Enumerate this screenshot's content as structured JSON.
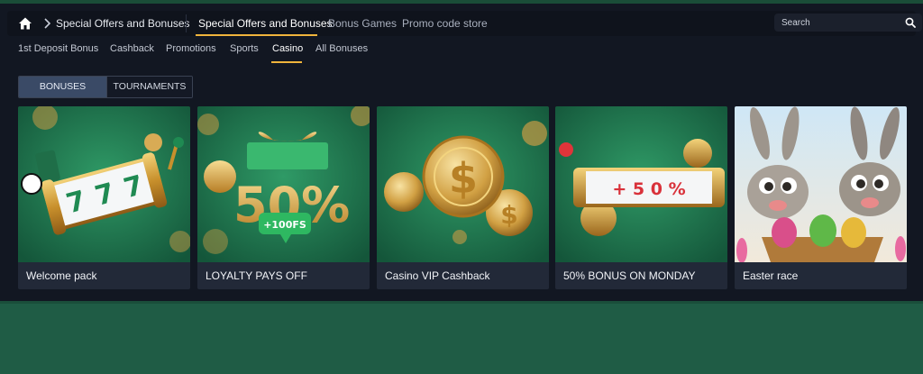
{
  "breadcrumb": {
    "label": "Special Offers and Bonuses"
  },
  "main_tabs": [
    {
      "label": "Special Offers and Bonuses",
      "active": true
    },
    {
      "label": "Bonus Games",
      "active": false
    },
    {
      "label": "Promo code store",
      "active": false
    }
  ],
  "search": {
    "placeholder": "Search"
  },
  "sub_tabs": [
    {
      "label": "1st Deposit Bonus"
    },
    {
      "label": "Cashback"
    },
    {
      "label": "Promotions"
    },
    {
      "label": "Sports"
    },
    {
      "label": "Casino",
      "active": true
    },
    {
      "label": "All Bonuses"
    }
  ],
  "toggle": {
    "bonuses": "BONUSES",
    "tournaments": "TOURNAMENTS",
    "selected": "BONUSES"
  },
  "cards": [
    {
      "title": "Welcome pack",
      "art": "slot-machine-777"
    },
    {
      "title": "LOYALTY PAYS OFF",
      "art": "gift-50-percent",
      "badge": "+100FS",
      "number": "50%"
    },
    {
      "title": "Casino VIP Cashback",
      "art": "gold-dollar-coins"
    },
    {
      "title": "50% BONUS ON MONDAY",
      "art": "slot-reel-50-percent",
      "reel": "+ 5 0 %"
    },
    {
      "title": "Easter race",
      "art": "easter-bunnies"
    }
  ],
  "colors": {
    "accent": "#f0b43c",
    "panel": "#121722",
    "green": "#1e5a43"
  }
}
